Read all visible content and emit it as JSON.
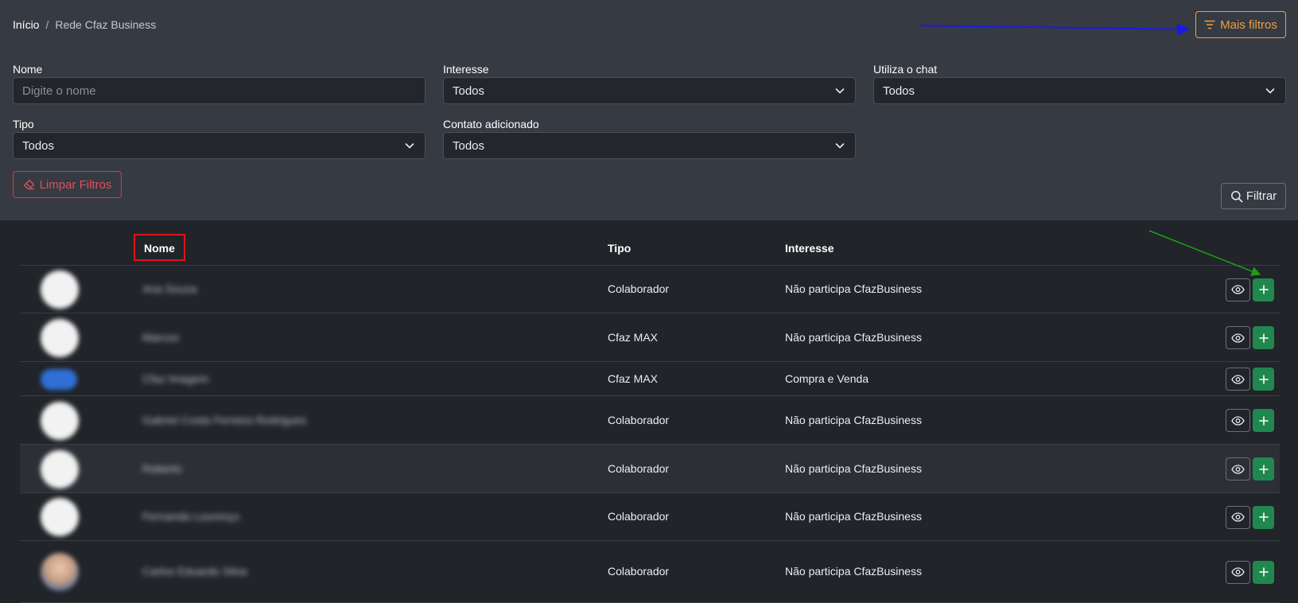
{
  "breadcrumb": {
    "home": "Início",
    "separator": "/",
    "current": "Rede Cfaz Business"
  },
  "more_filters_label": "Mais filtros",
  "filters": {
    "nome": {
      "label": "Nome",
      "placeholder": "Digite o nome"
    },
    "interesse": {
      "label": "Interesse",
      "value": "Todos"
    },
    "chat": {
      "label": "Utiliza o chat",
      "value": "Todos"
    },
    "tipo": {
      "label": "Tipo",
      "value": "Todos"
    },
    "contato": {
      "label": "Contato adicionado",
      "value": "Todos"
    }
  },
  "clear_label": "Limpar Filtros",
  "filter_label": "Filtrar",
  "table": {
    "headers": {
      "nome": "Nome",
      "tipo": "Tipo",
      "interesse": "Interesse"
    },
    "rows": [
      {
        "name": "Ana Souza",
        "tipo": "Colaborador",
        "interesse": "Não participa CfazBusiness",
        "avatar": "white"
      },
      {
        "name": "Marcos",
        "tipo": "Cfaz MAX",
        "interesse": "Não participa CfazBusiness",
        "avatar": "white"
      },
      {
        "name": "Cfaz Imagem",
        "tipo": "Cfaz MAX",
        "interesse": "Compra e Venda",
        "avatar": "blue"
      },
      {
        "name": "Gabriel Costa Ferreira Rodrigues",
        "tipo": "Colaborador",
        "interesse": "Não participa CfazBusiness",
        "avatar": "white"
      },
      {
        "name": "Roberto",
        "tipo": "Colaborador",
        "interesse": "Não participa CfazBusiness",
        "avatar": "white"
      },
      {
        "name": "Fernanda Lourenço",
        "tipo": "Colaborador",
        "interesse": "Não participa CfazBusiness",
        "avatar": "white"
      },
      {
        "name": "Carlos Eduardo Silva",
        "tipo": "Colaborador",
        "interesse": "Não participa CfazBusiness",
        "avatar": "photo"
      }
    ]
  },
  "colors": {
    "accent_orange": "#f0a040",
    "danger": "#d63b48",
    "success": "#20884e",
    "annotation_blue": "#1a1ae6",
    "annotation_green": "#1f9a1f",
    "annotation_red": "#e0121f"
  },
  "icons": {
    "more_filters": "filter-lines-icon",
    "clear": "eraser-icon",
    "filter": "search-icon",
    "select": "chevron-down-icon",
    "view": "eye-icon",
    "add": "plus-icon"
  }
}
